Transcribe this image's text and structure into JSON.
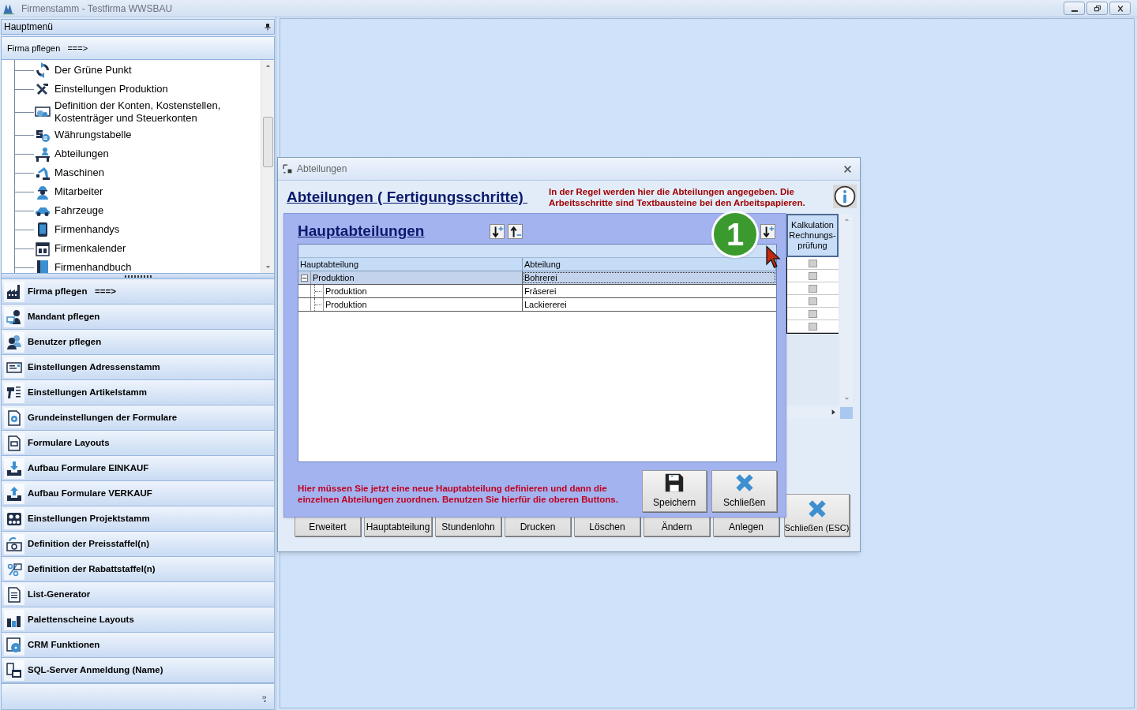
{
  "window": {
    "title": "Firmenstamm - Testfirma WWSBAU"
  },
  "main_menu": {
    "title": "Hauptmenü",
    "current_group": "Firma pflegen   ===>",
    "tree_items": [
      {
        "label": "Der Grüne Punkt"
      },
      {
        "label": "Einstellungen Produktion"
      },
      {
        "label": "Definition der Konten, Kostenstellen, Kostenträger und Steuerkonten"
      },
      {
        "label": "Währungstabelle"
      },
      {
        "label": "Abteilungen"
      },
      {
        "label": "Maschinen"
      },
      {
        "label": "Mitarbeiter"
      },
      {
        "label": "Fahrzeuge"
      },
      {
        "label": "Firmenhandys"
      },
      {
        "label": "Firmenkalender"
      },
      {
        "label": "Firmenhandbuch"
      }
    ],
    "groups": [
      "Firma pflegen   ===>",
      "Mandant pflegen",
      "Benutzer pflegen",
      "Einstellungen Adressenstamm",
      "Einstellungen Artikelstamm",
      "Grundeinstellungen der Formulare",
      "Formulare Layouts",
      "Aufbau Formulare EINKAUF",
      "Aufbau Formulare VERKAUF",
      "Einstellungen Projektstamm",
      "Definition der Preisstaffel(n)",
      "Definition der Rabattstaffel(n)",
      "List-Generator",
      "Palettenscheine Layouts",
      "CRM Funktionen",
      "SQL-Server Anmeldung (Name)"
    ]
  },
  "dialog": {
    "title": "Abteilungen",
    "heading": "Abteilungen ( Fertigungsschritte) ",
    "note": "In der Regel werden hier die Abteilungen angegeben. Die Arbeitsschritte sind Textbausteine bei den Arbeitspapieren.",
    "column": "Kalkulation Rechnungs-prüfung",
    "checkboxes": [
      {
        "checked": false
      },
      {
        "checked": false
      },
      {
        "checked": false
      },
      {
        "checked": false
      },
      {
        "checked": false
      },
      {
        "checked": false
      }
    ],
    "buttons": [
      "Erweitert",
      "Hauptabteilung",
      "Stundenlohn",
      "Drucken",
      "Löschen",
      "Ändern",
      "Anlegen"
    ],
    "close_button": "Schließen (ESC)"
  },
  "overlay": {
    "title": "Hauptabteilungen",
    "badge": "1",
    "columns": [
      "Hauptabteilung",
      "Abteilung"
    ],
    "rows": [
      {
        "kind": "group",
        "expanded": true,
        "selected": true,
        "cells": [
          "Produktion",
          "Bohrerei"
        ]
      },
      {
        "kind": "child",
        "selected": false,
        "cells": [
          "Produktion",
          "Fräserei"
        ]
      },
      {
        "kind": "child",
        "selected": false,
        "cells": [
          "Produktion",
          "Lackiererei"
        ]
      }
    ],
    "note": "Hier müssen Sie jetzt eine neue Hauptabteilung definieren und dann die einzelnen Abteilungen zuordnen. Benutzen Sie hierfür die oberen Buttons.",
    "buttons": [
      "Speichern",
      "Schließen"
    ]
  }
}
